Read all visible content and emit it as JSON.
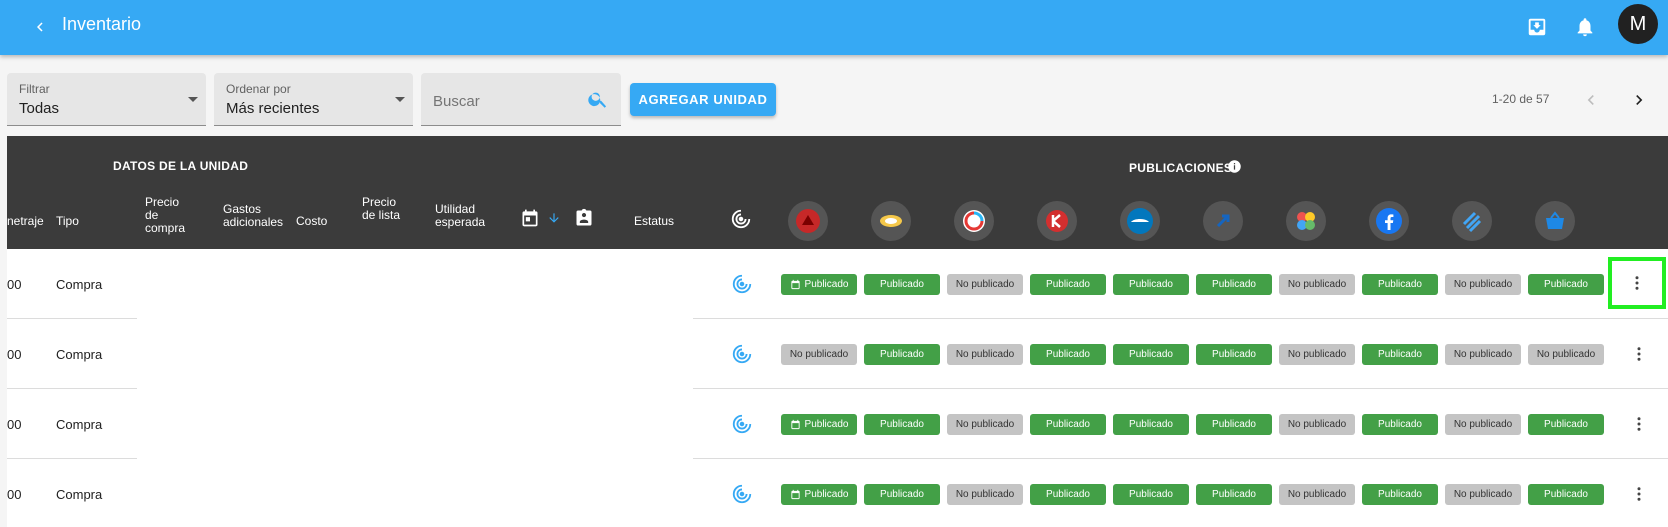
{
  "app": {
    "title": "Inventario",
    "avatar_initial": "M",
    "accent": "#36a9f4"
  },
  "toolbar": {
    "filter": {
      "label": "Filtrar",
      "value": "Todas"
    },
    "sort": {
      "label": "Ordenar por",
      "value": "Más recientes"
    },
    "search": {
      "placeholder": "Buscar"
    },
    "add_button": "AGREGAR UNIDAD",
    "pagination": "1-20 de 57"
  },
  "table": {
    "group_unit": "DATOS DE LA UNIDAD",
    "group_pubs": "PUBLICACIONES",
    "columns": {
      "kilometraje": "netraje",
      "tipo": "Tipo",
      "precio_compra": "Precio de compra",
      "gastos": "Gastos adicionales",
      "costo": "Costo",
      "precio_lista": "Precio de lista",
      "utilidad": "Utilidad esperada",
      "estatus": "Estatus"
    },
    "platform_icons": [
      "platform-1-icon",
      "platform-2-icon",
      "platform-3-icon",
      "platform-4-icon",
      "platform-5-icon",
      "platform-6-icon",
      "platform-7-icon",
      "facebook-icon",
      "platform-9-icon",
      "platform-10-icon"
    ],
    "status_labels": {
      "pub": "Publicado",
      "nopub": "No publicado"
    },
    "rows": [
      {
        "km": "00",
        "tipo": "Compra",
        "chips": [
          "Publicado",
          "Publicado",
          "No publicado",
          "Publicado",
          "Publicado",
          "Publicado",
          "No publicado",
          "Publicado",
          "No publicado",
          "Publicado"
        ],
        "first_has_calendar": true
      },
      {
        "km": "00",
        "tipo": "Compra",
        "chips": [
          "No publicado",
          "Publicado",
          "No publicado",
          "Publicado",
          "Publicado",
          "Publicado",
          "No publicado",
          "Publicado",
          "No publicado",
          "No publicado"
        ],
        "first_has_calendar": false
      },
      {
        "km": "00",
        "tipo": "Compra",
        "chips": [
          "Publicado",
          "Publicado",
          "No publicado",
          "Publicado",
          "Publicado",
          "Publicado",
          "No publicado",
          "Publicado",
          "No publicado",
          "Publicado"
        ],
        "first_has_calendar": true
      },
      {
        "km": "00",
        "tipo": "Compra",
        "chips": [
          "Publicado",
          "Publicado",
          "No publicado",
          "Publicado",
          "Publicado",
          "Publicado",
          "No publicado",
          "Publicado",
          "No publicado",
          "Publicado"
        ],
        "first_has_calendar": true
      }
    ]
  }
}
